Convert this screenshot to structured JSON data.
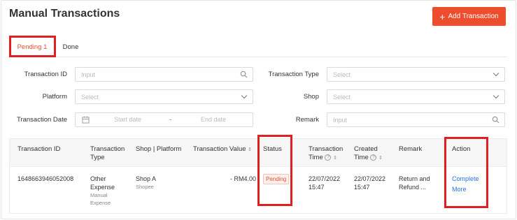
{
  "header": {
    "title": "Manual Transactions",
    "add_button_label": "Add Transaction"
  },
  "tabs": [
    {
      "label": "Pending 1",
      "active": true
    },
    {
      "label": "Done",
      "active": false
    }
  ],
  "filters": {
    "transaction_id": {
      "label": "Transaction ID",
      "placeholder": "Input"
    },
    "transaction_type": {
      "label": "Transaction Type",
      "placeholder": "Select"
    },
    "platform": {
      "label": "Platform",
      "placeholder": "Select"
    },
    "shop": {
      "label": "Shop",
      "placeholder": "Select"
    },
    "transaction_date": {
      "label": "Transaction Date",
      "start_placeholder": "Start date",
      "separator": "-",
      "end_placeholder": "End date"
    },
    "remark": {
      "label": "Remark",
      "placeholder": "Input"
    }
  },
  "table": {
    "columns": {
      "transaction_id": "Transaction ID",
      "transaction_type_1": "Transaction",
      "transaction_type_2": "Type",
      "shop_platform": "Shop | Platform",
      "transaction_value": "Transaction Value",
      "status": "Status",
      "transaction_time_1": "Transaction",
      "transaction_time_2": "Time",
      "created_time_1": "Created",
      "created_time_2": "Time",
      "remark": "Remark",
      "action": "Action"
    },
    "rows": [
      {
        "transaction_id": "1648663946052008",
        "type_line1": "Other",
        "type_line2": "Expense",
        "type_sub1": "Manual",
        "type_sub2": "Expense",
        "shop": "Shop A",
        "platform": "Shopee",
        "value": "- RM4.00",
        "status": "Pending",
        "transaction_date": "22/07/2022",
        "transaction_clock": "15:47",
        "created_date": "22/07/2022",
        "created_clock": "15:47",
        "remark_line1": "Return and",
        "remark_line2": "Refund ...",
        "action_complete": "Complete",
        "action_more": "More"
      }
    ]
  },
  "colors": {
    "accent": "#ee4d2d",
    "link": "#2673dd",
    "highlight_box": "#e02020"
  },
  "icons": [
    "plus-icon",
    "search-icon",
    "chevron-down-icon",
    "calendar-icon",
    "sort-icon",
    "help-icon"
  ]
}
